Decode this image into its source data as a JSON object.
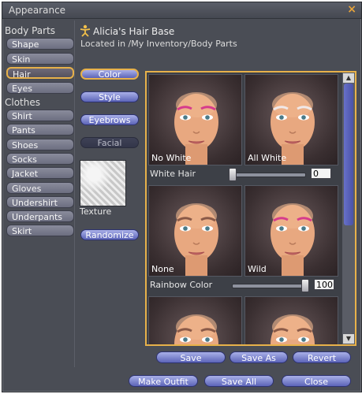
{
  "window": {
    "title": "Appearance",
    "close_glyph": "×"
  },
  "sidebar": {
    "body_parts_heading": "Body Parts",
    "body_parts": [
      {
        "label": "Shape"
      },
      {
        "label": "Skin"
      },
      {
        "label": "Hair",
        "selected": true
      },
      {
        "label": "Eyes"
      }
    ],
    "clothes_heading": "Clothes",
    "clothes": [
      {
        "label": "Shirt"
      },
      {
        "label": "Pants"
      },
      {
        "label": "Shoes"
      },
      {
        "label": "Socks"
      },
      {
        "label": "Jacket"
      },
      {
        "label": "Gloves"
      },
      {
        "label": "Undershirt"
      },
      {
        "label": "Underpants"
      },
      {
        "label": "Skirt"
      }
    ]
  },
  "editor": {
    "title": "Alicia's Hair Base",
    "location": "Located in /My Inventory/Body Parts",
    "tabs": [
      {
        "label": "Color",
        "selected": true
      },
      {
        "label": "Style"
      },
      {
        "label": "Eyebrows"
      },
      {
        "label": "Facial",
        "disabled": true
      }
    ],
    "texture_label": "Texture",
    "randomize_label": "Randomize"
  },
  "grid": {
    "rows": [
      {
        "tiles": [
          {
            "caption": "No White",
            "brow_color": "#d63c8c"
          },
          {
            "caption": "All White",
            "brow_color": "#f0e8e8"
          }
        ],
        "slider": {
          "label": "White Hair",
          "value": "0",
          "fraction": 0.0
        }
      },
      {
        "tiles": [
          {
            "caption": "None",
            "brow_color": "#8a5a48"
          },
          {
            "caption": "Wild",
            "brow_color": "#d63c8c"
          }
        ],
        "slider": {
          "label": "Rainbow Color",
          "value": "100",
          "fraction": 1.0
        }
      },
      {
        "tiles": [
          {
            "caption": "",
            "brow_color": "#8a5a48"
          },
          {
            "caption": "",
            "brow_color": "#8a5a48"
          }
        ]
      }
    ]
  },
  "actions": {
    "save": "Save",
    "save_as": "Save As",
    "revert": "Revert"
  },
  "footer": {
    "make_outfit": "Make Outfit",
    "save_all": "Save All",
    "close": "Close"
  },
  "colors": {
    "accent": "#e7b14a",
    "button": "#6d75c8",
    "window_bg": "#4a4d55"
  }
}
